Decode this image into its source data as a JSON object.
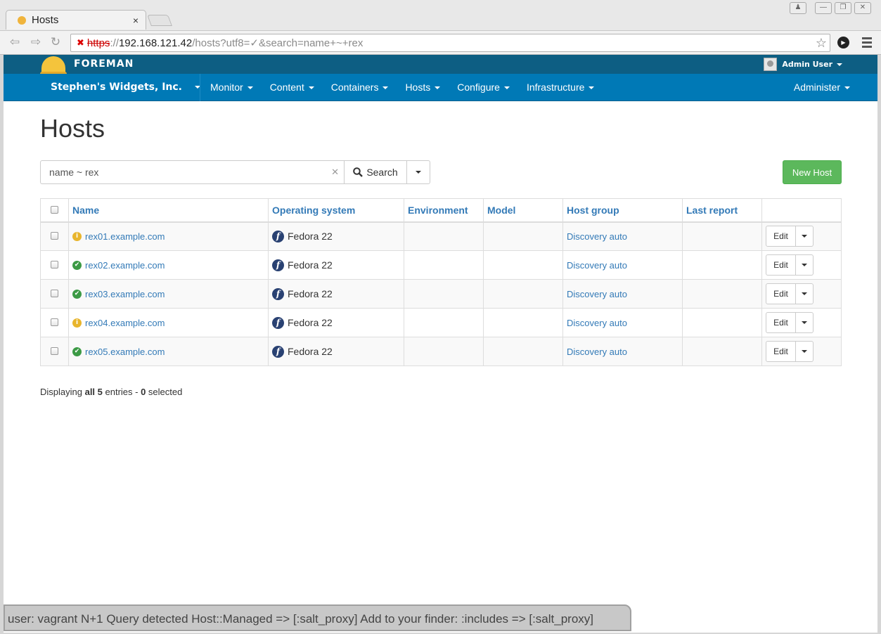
{
  "browser": {
    "tab_title": "Hosts",
    "tab_close": "×",
    "url_scheme": "https",
    "url_separator": "://",
    "url_host": "192.168.121.42",
    "url_path": "/hosts?utf8=✓&search=name+~+rex"
  },
  "header": {
    "brand": "FOREMAN",
    "user": "Admin User",
    "organization": "Stephen's Widgets, Inc.",
    "nav": [
      "Monitor",
      "Content",
      "Containers",
      "Hosts",
      "Configure",
      "Infrastructure"
    ],
    "admin": "Administer"
  },
  "page": {
    "title": "Hosts",
    "search_value": "name ~ rex",
    "search_button": "Search",
    "new_host_button": "New Host"
  },
  "table": {
    "columns": [
      "Name",
      "Operating system",
      "Environment",
      "Model",
      "Host group",
      "Last report"
    ],
    "rows": [
      {
        "name": "rex01.example.com",
        "status": "warning",
        "status_glyph": "i",
        "os": "Fedora 22",
        "environment": "",
        "model": "",
        "hostgroup": "Discovery auto",
        "last_report": "",
        "action": "Edit"
      },
      {
        "name": "rex02.example.com",
        "status": "ok",
        "status_glyph": "✔",
        "os": "Fedora 22",
        "environment": "",
        "model": "",
        "hostgroup": "Discovery auto",
        "last_report": "",
        "action": "Edit"
      },
      {
        "name": "rex03.example.com",
        "status": "ok",
        "status_glyph": "✔",
        "os": "Fedora 22",
        "environment": "",
        "model": "",
        "hostgroup": "Discovery auto",
        "last_report": "",
        "action": "Edit"
      },
      {
        "name": "rex04.example.com",
        "status": "warning",
        "status_glyph": "i",
        "os": "Fedora 22",
        "environment": "",
        "model": "",
        "hostgroup": "Discovery auto",
        "last_report": "",
        "action": "Edit"
      },
      {
        "name": "rex05.example.com",
        "status": "ok",
        "status_glyph": "✔",
        "os": "Fedora 22",
        "environment": "",
        "model": "",
        "hostgroup": "Discovery auto",
        "last_report": "",
        "action": "Edit"
      }
    ]
  },
  "summary": {
    "prefix": "Displaying ",
    "all_label": "all 5",
    "middle": " entries - ",
    "selected_count": "0",
    "suffix": " selected"
  },
  "notice": "user: vagrant N+1 Query detected Host::Managed => [:salt_proxy] Add to your finder: :includes => [:salt_proxy]",
  "colors": {
    "topbar": "#0d5e83",
    "navbar": "#0079b6",
    "link": "#337ab7",
    "new_host": "#5cb85c",
    "status_ok": "#3c9a45",
    "status_warning": "#e8b52d"
  },
  "icons": {
    "status_ok": "check-circle-icon",
    "status_warning": "info-circle-icon",
    "os": "fedora-logo-icon",
    "search": "magnifier-icon"
  }
}
